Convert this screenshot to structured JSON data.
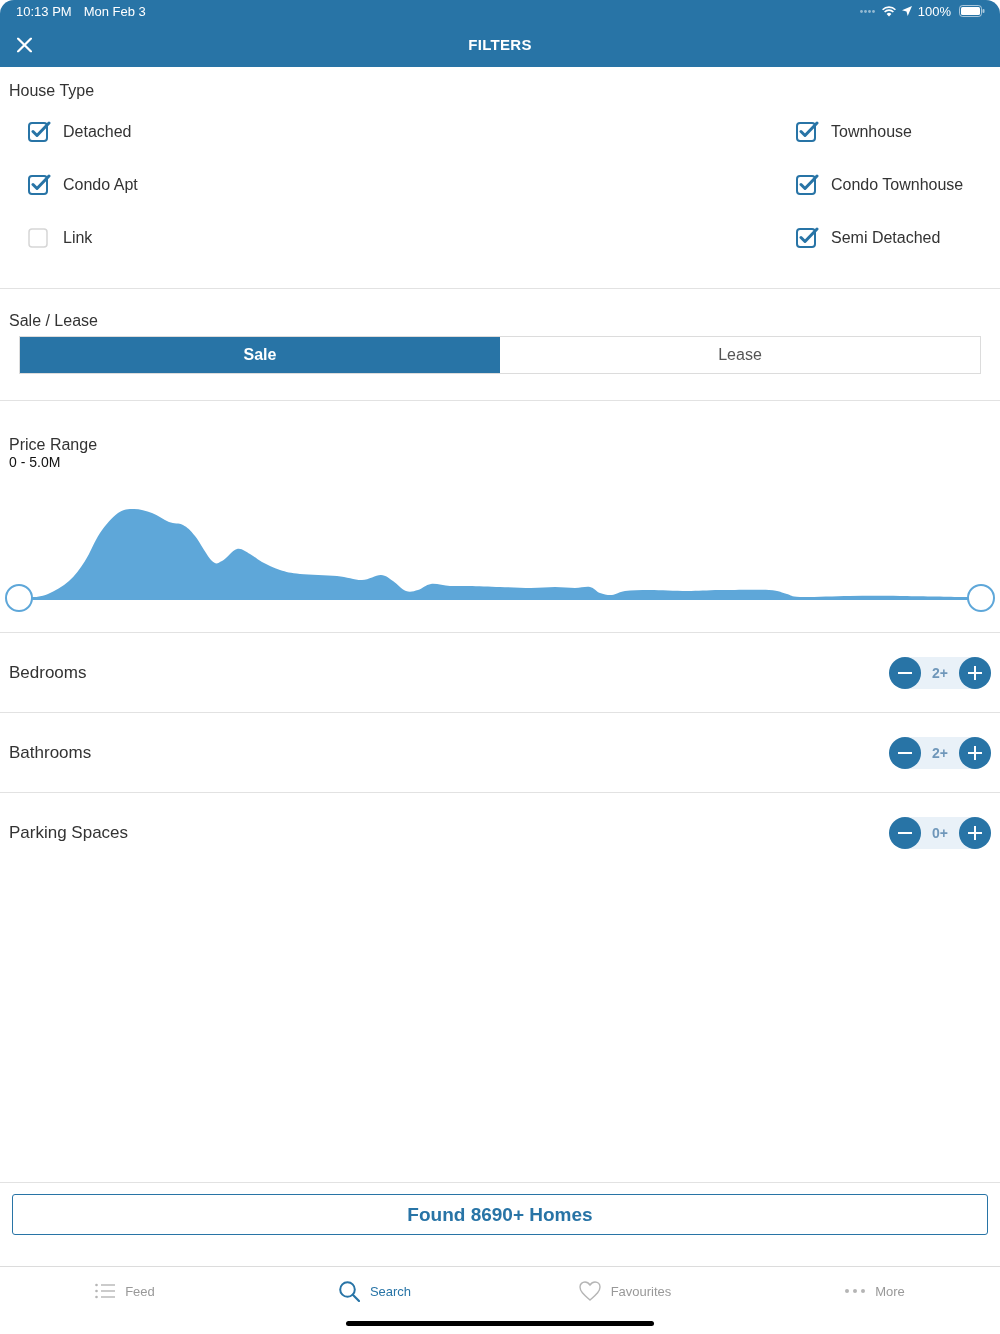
{
  "status_bar": {
    "time": "10:13 PM",
    "date": "Mon Feb 3",
    "battery": "100%"
  },
  "nav_bar": {
    "title": "FILTERS"
  },
  "house_type": {
    "label": "House Type",
    "options": [
      {
        "label": "Detached",
        "checked": true
      },
      {
        "label": "Townhouse",
        "checked": true
      },
      {
        "label": "Condo Apt",
        "checked": true
      },
      {
        "label": "Condo Townhouse",
        "checked": true
      },
      {
        "label": "Link",
        "checked": false
      },
      {
        "label": "Semi Detached",
        "checked": true
      }
    ]
  },
  "sale_lease": {
    "label": "Sale / Lease",
    "tabs": [
      {
        "label": "Sale",
        "selected": true
      },
      {
        "label": "Lease",
        "selected": false
      }
    ]
  },
  "price_range": {
    "label": "Price Range",
    "value": "0 - 5.0M",
    "handles": [
      {
        "level": 0
      },
      {
        "level": 1
      }
    ]
  },
  "counters": [
    {
      "label": "Bedrooms",
      "value": "2+"
    },
    {
      "label": "Bathrooms",
      "value": "2+"
    },
    {
      "label": "Parking Spaces",
      "value": "0+"
    }
  ],
  "results_button": {
    "label": "Found 8690+ Homes"
  },
  "tab_bar": {
    "items": [
      {
        "label": "Feed",
        "selected": false
      },
      {
        "label": "Search",
        "selected": true
      },
      {
        "label": "Favourites",
        "selected": false
      },
      {
        "label": "More",
        "selected": false
      }
    ]
  }
}
